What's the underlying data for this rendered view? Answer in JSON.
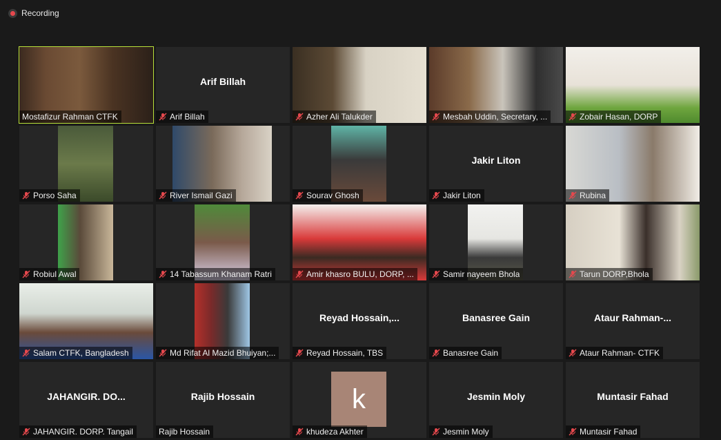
{
  "recording": {
    "label": "Recording"
  },
  "colors": {
    "active_speaker": "#b9e23a",
    "mute": "#e5484d",
    "background": "#1a1a1a",
    "tile": "#262626"
  },
  "participants": [
    {
      "label": "Mostafizur Rahman CTFK",
      "muted": false,
      "active": true
    },
    {
      "label": "Arif Billah",
      "center": "Arif Billah",
      "muted": true
    },
    {
      "label": "Azher Ali Talukder",
      "muted": true
    },
    {
      "label": "Mesbah Uddin, Secretary, ...",
      "muted": true
    },
    {
      "label": "Zobair Hasan, DORP",
      "muted": true
    },
    {
      "label": "Porso Saha",
      "muted": true
    },
    {
      "label": "River Ismail Gazi",
      "muted": true
    },
    {
      "label": "Sourav Ghosh",
      "muted": true
    },
    {
      "label": "Jakir Liton",
      "center": "Jakir Liton",
      "muted": true
    },
    {
      "label": "Rubina",
      "muted": true
    },
    {
      "label": "Robiul Awal",
      "muted": true
    },
    {
      "label": "14 Tabassum Khanam Ratri",
      "muted": true
    },
    {
      "label": "Amir khasro BULU, DORP, ...",
      "muted": true
    },
    {
      "label": "Samir nayeem Bhola",
      "muted": true
    },
    {
      "label": "Tarun DORP,Bhola",
      "muted": true
    },
    {
      "label": "Salam CTFK, Bangladesh",
      "muted": true
    },
    {
      "label": "Md Rifat Al Mazid Bhuiyan;...",
      "muted": true
    },
    {
      "label": "Reyad Hossain, TBS",
      "center": "Reyad  Hossain,...",
      "muted": true
    },
    {
      "label": "Banasree Gain",
      "center": "Banasree Gain",
      "muted": true
    },
    {
      "label": "Ataur Rahman- CTFK",
      "center": "Ataur  Rahman-...",
      "muted": true
    },
    {
      "label": "JAHANGIR. DORP. Tangail",
      "center": "JAHANGIR.  DO...",
      "muted": true
    },
    {
      "label": "Rajib Hossain",
      "center": "Rajib Hossain",
      "muted": false
    },
    {
      "label": "khudeza Akhter",
      "avatar": "k",
      "muted": true
    },
    {
      "label": "Jesmin Moly",
      "center": "Jesmin Moly",
      "muted": true
    },
    {
      "label": "Muntasir Fahad",
      "center": "Muntasir Fahad",
      "muted": true
    }
  ]
}
